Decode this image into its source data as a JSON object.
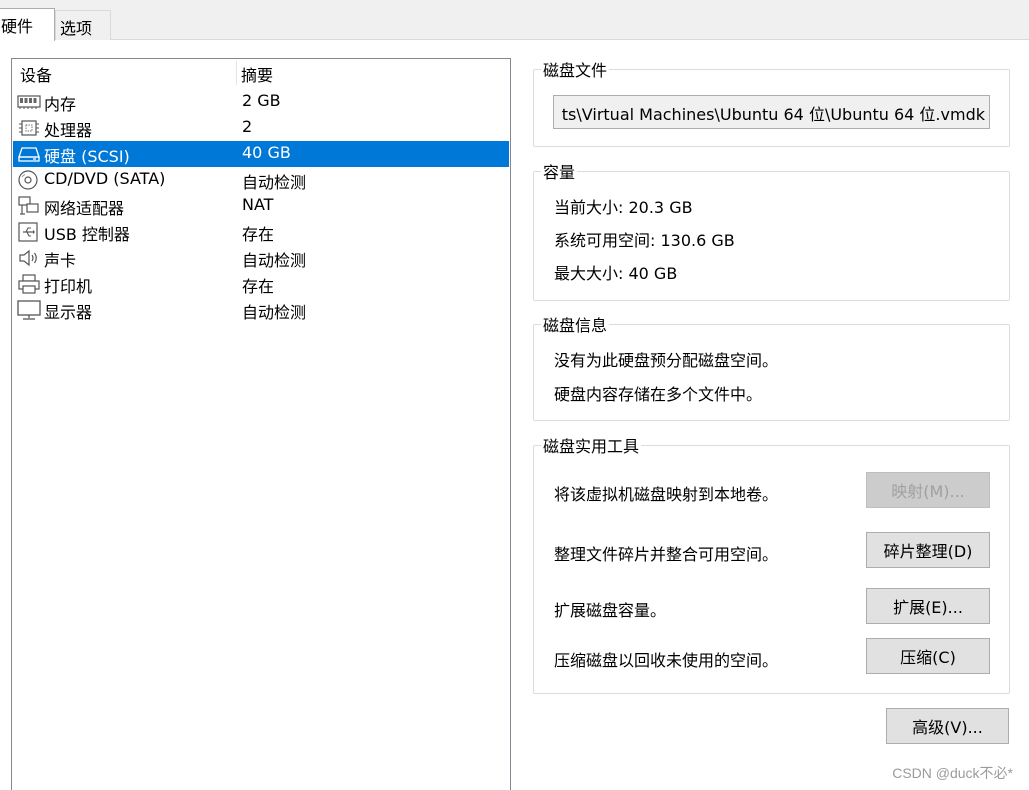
{
  "tabs": {
    "hardware": "硬件",
    "options": "选项"
  },
  "device_list": {
    "header": {
      "device": "设备",
      "summary": "摘要"
    },
    "devices": [
      {
        "name": "内存",
        "summary": "2 GB",
        "icon": "memory-icon"
      },
      {
        "name": "处理器",
        "summary": "2",
        "icon": "cpu-icon"
      },
      {
        "name": "硬盘 (SCSI)",
        "summary": "40 GB",
        "icon": "hard-disk-icon",
        "selected": true
      },
      {
        "name": "CD/DVD (SATA)",
        "summary": "自动检测",
        "icon": "cd-dvd-icon"
      },
      {
        "name": "网络适配器",
        "summary": "NAT",
        "icon": "network-icon"
      },
      {
        "name": "USB 控制器",
        "summary": "存在",
        "icon": "usb-icon"
      },
      {
        "name": "声卡",
        "summary": "自动检测",
        "icon": "speaker-icon"
      },
      {
        "name": "打印机",
        "summary": "存在",
        "icon": "printer-icon"
      },
      {
        "name": "显示器",
        "summary": "自动检测",
        "icon": "monitor-icon"
      }
    ]
  },
  "disk_file": {
    "title": "磁盘文件",
    "path": "ts\\Virtual Machines\\Ubuntu 64 位\\Ubuntu 64 位.vmdk"
  },
  "capacity": {
    "title": "容量",
    "current_size": "当前大小: 20.3 GB",
    "system_available": "系统可用空间: 130.6 GB",
    "max_size": "最大大小: 40 GB"
  },
  "disk_info": {
    "title": "磁盘信息",
    "line1": "没有为此硬盘预分配磁盘空间。",
    "line2": "硬盘内容存储在多个文件中。"
  },
  "disk_utilities": {
    "title": "磁盘实用工具",
    "map_desc": "将该虚拟机磁盘映射到本地卷。",
    "map_button": "映射(M)...",
    "defrag_desc": "整理文件碎片并整合可用空间。",
    "defrag_button": "碎片整理(D)",
    "expand_desc": "扩展磁盘容量。",
    "expand_button": "扩展(E)...",
    "compact_desc": "压缩磁盘以回收未使用的空间。",
    "compact_button": "压缩(C)"
  },
  "advanced_button": "高级(V)...",
  "watermark": "CSDN @duck不必*",
  "colors": {
    "selection": "#0078d7",
    "button_face": "#e1e1e1",
    "group_border": "#dcdcdc"
  }
}
